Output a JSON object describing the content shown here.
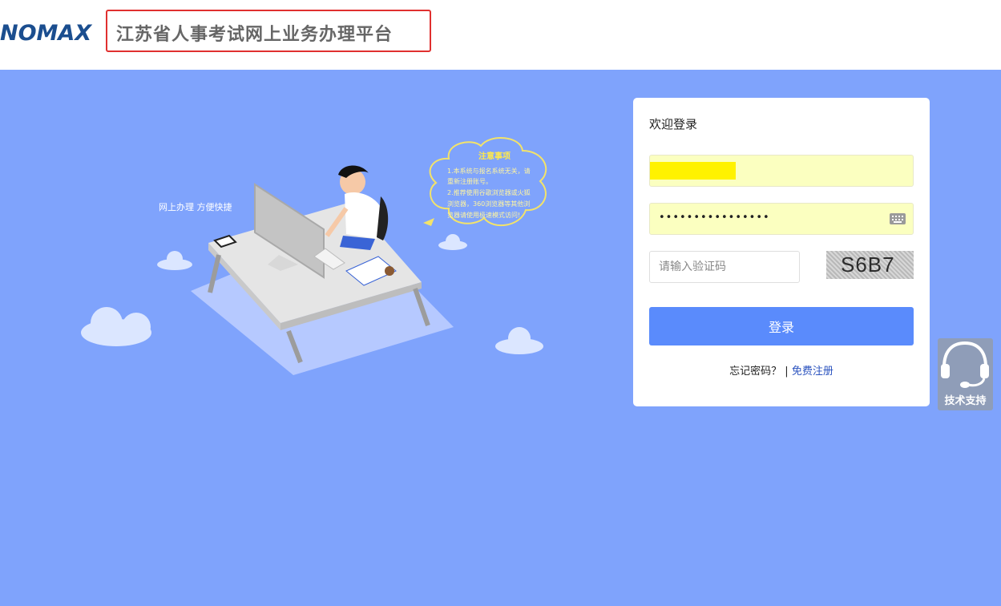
{
  "header": {
    "logo_text": "NOMAX",
    "title": "江苏省人事考试网上业务办理平台"
  },
  "illustration": {
    "slogan": "网上办理 方便快捷",
    "notice_title": "注意事项",
    "notice_lines": [
      "1.本系统与报名系统无关，请",
      "重新注册账号。",
      "2.推荐使用谷歌浏览器或火狐",
      "浏览器，360浏览器等其他浏",
      "览器请使用极速模式访问!"
    ]
  },
  "login": {
    "welcome": "欢迎登录",
    "password_mask": "••••••••••••••••",
    "captcha_placeholder": "请输入验证码",
    "captcha_code": "S6B7",
    "submit_label": "登录",
    "forgot_label": "忘记密码？",
    "separator": "|",
    "register_label": "免费注册"
  },
  "support": {
    "label": "技术支持"
  },
  "colors": {
    "background": "#7fa3fc",
    "button": "#5a8bfc",
    "autofill": "#fbffc0",
    "title_highlight": "#e0302f",
    "logo_blue": "#1b4e8f"
  }
}
